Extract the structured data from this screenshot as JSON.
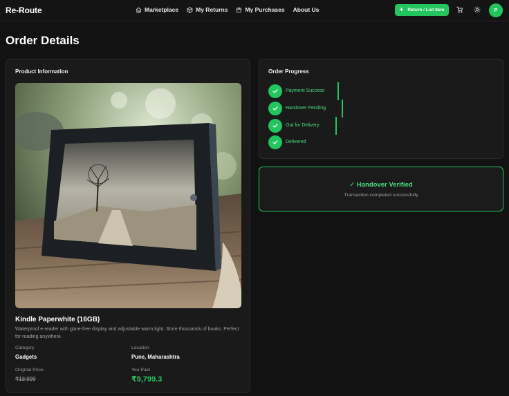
{
  "nav": {
    "brand": "Re-Route",
    "links": [
      {
        "label": "Marketplace",
        "icon": "home-icon"
      },
      {
        "label": "My Returns",
        "icon": "package-icon"
      },
      {
        "label": "My Purchases",
        "icon": "calendar-icon"
      },
      {
        "label": "About Us",
        "icon": ""
      }
    ],
    "cta_label": "Return / List Item",
    "cta_icon": "plus-icon",
    "cart_icon": "cart-icon",
    "theme_icon": "sun-icon",
    "avatar_initial": "P"
  },
  "page": {
    "title": "Order Details"
  },
  "product": {
    "heading": "Product Information",
    "name": "Kindle Paperwhite (16GB)",
    "description": "Waterproof e-reader with glare-free display and adjustable warm light. Store thousands of books. Perfect for reading anywhere.",
    "category_label": "Category",
    "category": "Gadgets",
    "location_label": "Location",
    "location": "Pune, Maharashtra",
    "original_price_label": "Original Price",
    "original_price": "₹13,999",
    "you_paid_label": "You Paid",
    "you_paid": "₹9,799.3"
  },
  "progress": {
    "heading": "Order Progress",
    "steps": [
      {
        "label": "Payment Success",
        "status": "complete"
      },
      {
        "label": "Handover Pending",
        "status": "complete"
      },
      {
        "label": "Out for Delivery",
        "status": "complete"
      },
      {
        "label": "Delivered",
        "status": "complete"
      }
    ]
  },
  "verified": {
    "title": "✓ Handover Verified",
    "subtitle": "Transaction completed successfully"
  },
  "colors": {
    "background": "#121212",
    "card": "#1a1a1a",
    "accent": "#22c55e",
    "accent_text": "#4ade80",
    "muted": "#a1a1a1"
  }
}
